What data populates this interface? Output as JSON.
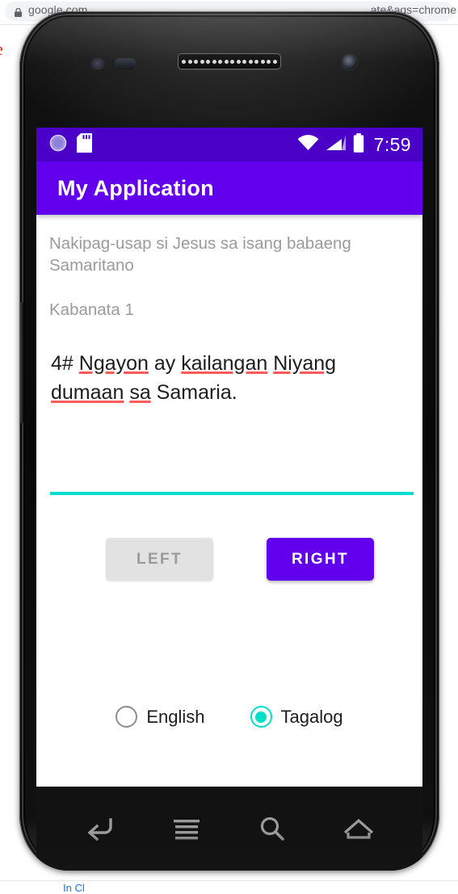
{
  "browser": {
    "url_head": "google.com",
    "url_tail": "ate&aqs=chrome",
    "lock_icon": "lock-icon",
    "page_red_text": "e",
    "page_bottom_text": "In Cl"
  },
  "phone": {
    "hardware": {
      "earpiece": "speaker-grille",
      "front_camera": "camera-icon",
      "proximity_sensor": "proximity-sensor-icon",
      "light_sensor": "light-sensor-icon",
      "volume_button": "volume-rocker"
    },
    "status_bar": {
      "background": "#4b00c8",
      "left_icons": [
        "sync-circle-icon",
        "sd-card-icon"
      ],
      "right_icons": [
        "wifi-icon",
        "cell-signal-icon",
        "battery-icon"
      ],
      "clock": "7:59"
    },
    "app_bar": {
      "title": "My Application",
      "background": "#6200ee",
      "text_color": "#ffffff"
    },
    "content": {
      "passage_title": "Nakipag-usap si Jesus sa isang babaeng Samaritano",
      "chapter_label": "Kabanata 1",
      "verse": {
        "full_text": "4# Ngayon ay kailangan Niyang dumaan sa Samaria.",
        "tokens": [
          {
            "text": "4# ",
            "misspelled": false
          },
          {
            "text": "Ngayon",
            "misspelled": true
          },
          {
            "text": " ay ",
            "misspelled": false
          },
          {
            "text": "kailangan",
            "misspelled": true
          },
          {
            "text": " ",
            "misspelled": false
          },
          {
            "text": "Niyang",
            "misspelled": true
          },
          {
            "text": " ",
            "misspelled": false
          },
          {
            "text": "dumaan",
            "misspelled": true
          },
          {
            "text": " ",
            "misspelled": false
          },
          {
            "text": "sa",
            "misspelled": true
          },
          {
            "text": " Samaria.",
            "misspelled": false
          }
        ],
        "spellcheck_underline_color": "#ff5a5a"
      },
      "divider_color": "#00ded2",
      "buttons": {
        "left": {
          "label": "LEFT",
          "enabled": false,
          "background": "#e2e2e2",
          "text_color": "#9a9a9a"
        },
        "right": {
          "label": "RIGHT",
          "enabled": true,
          "background": "#6200ee",
          "text_color": "#ffffff"
        }
      },
      "language_options": [
        {
          "label": "English",
          "selected": false
        },
        {
          "label": "Tagalog",
          "selected": true
        }
      ],
      "selected_language": "Tagalog",
      "radio_accent": "#00dfc8"
    },
    "nav_bar": {
      "background": "#121212",
      "buttons": [
        "back-icon",
        "menu-icon",
        "search-icon",
        "home-icon"
      ]
    }
  }
}
